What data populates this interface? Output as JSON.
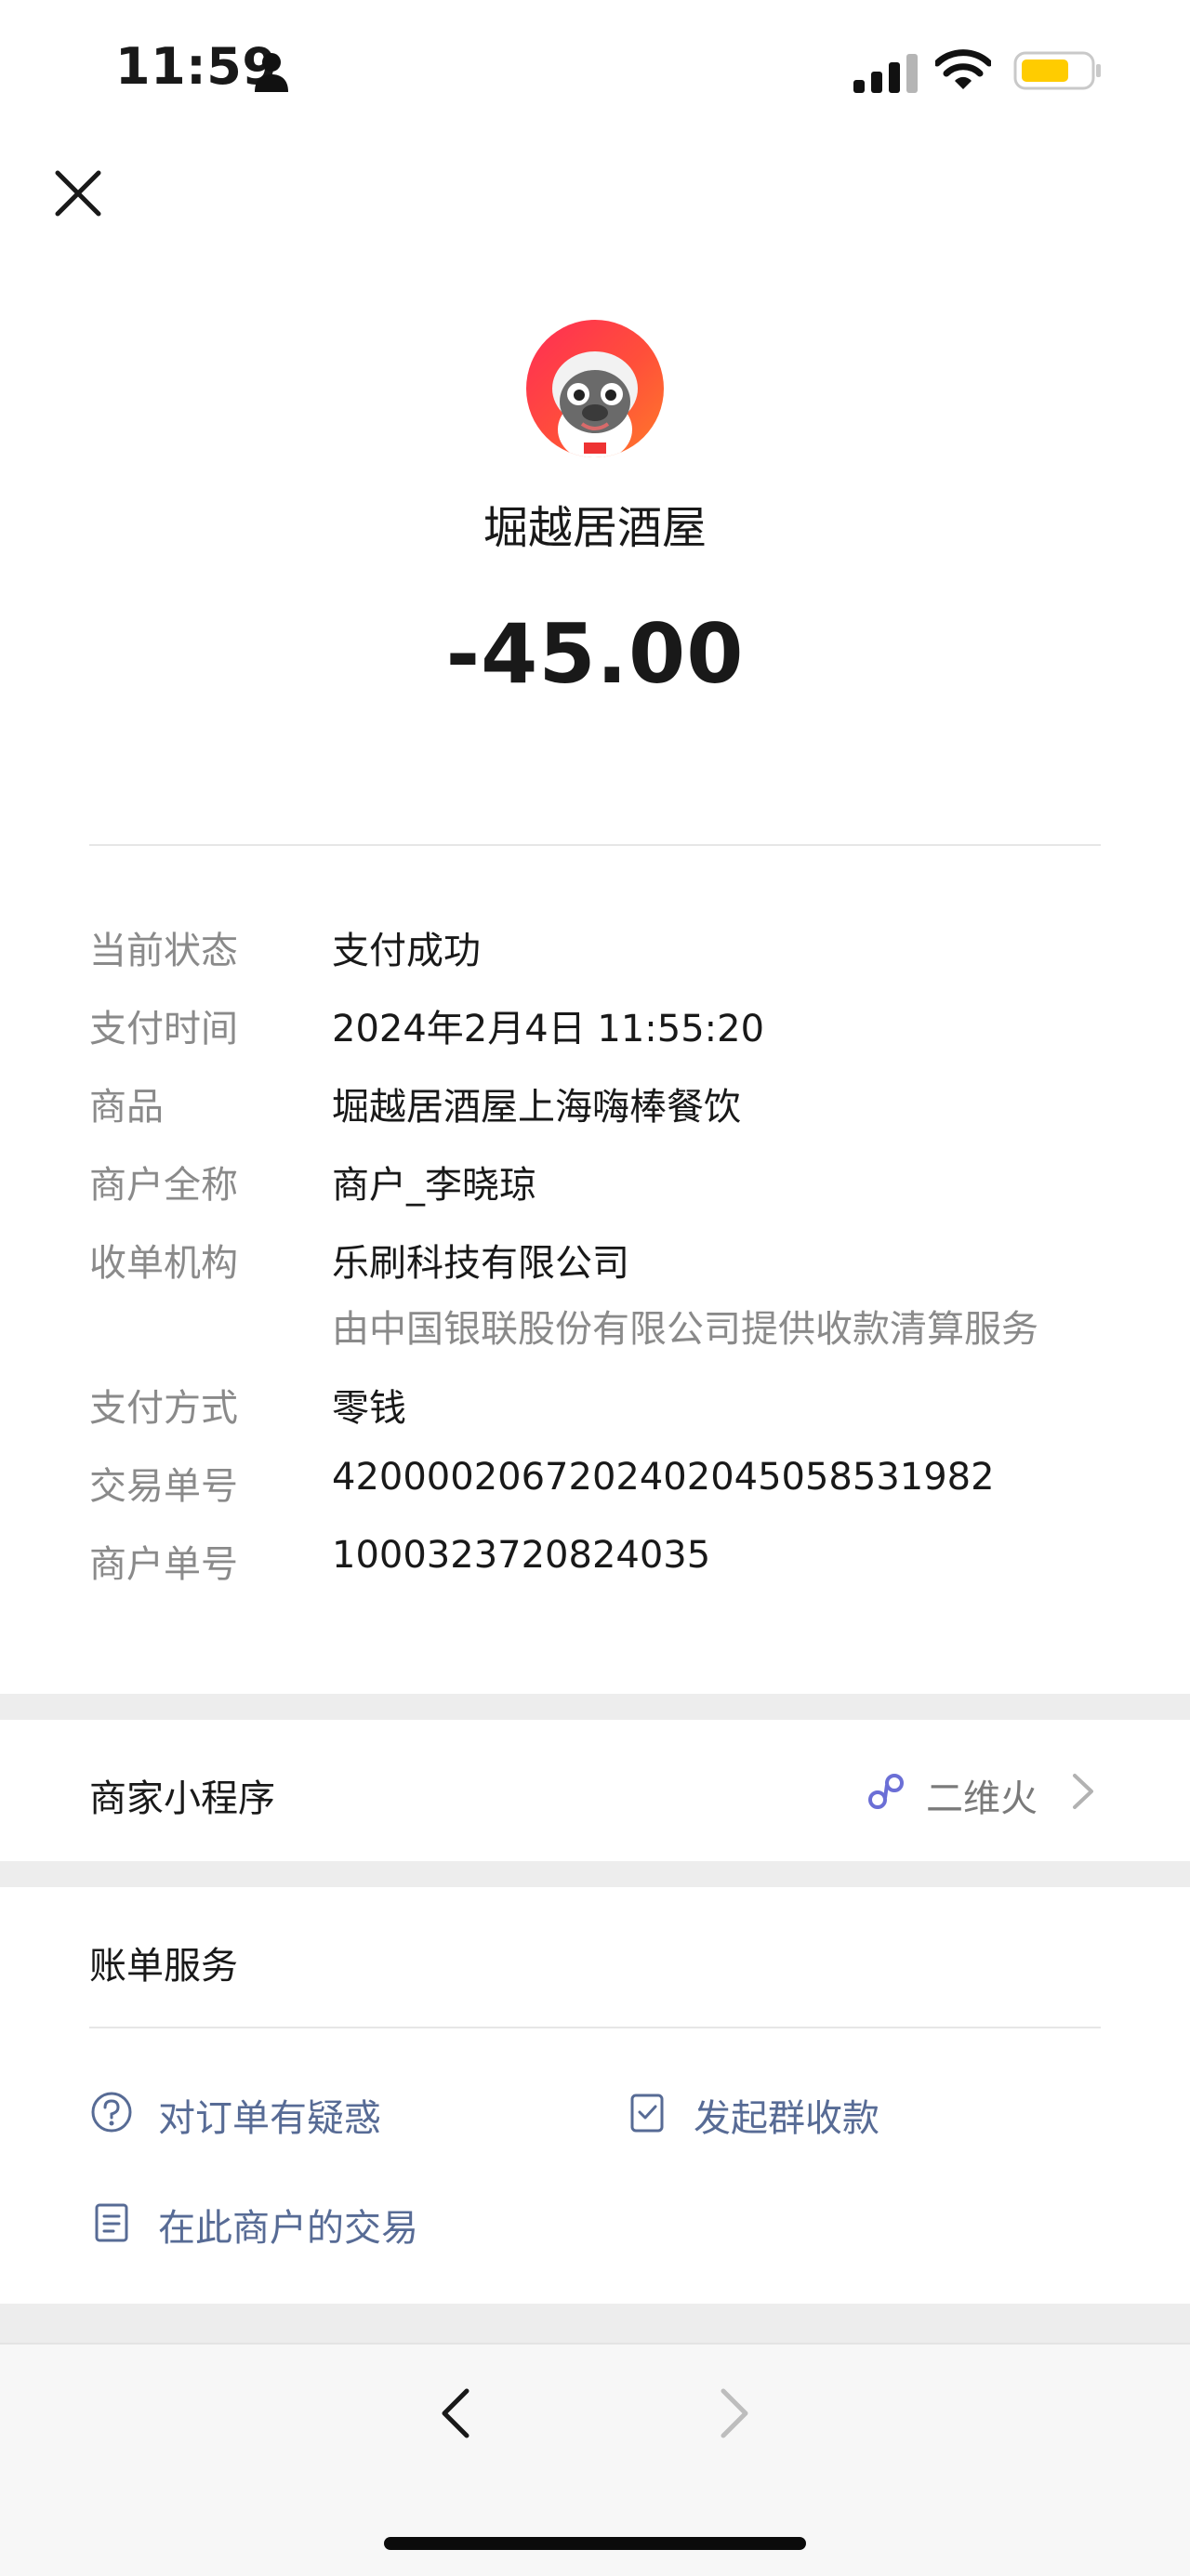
{
  "status_bar": {
    "time": "11:59",
    "battery_color": "#ffcc00"
  },
  "merchant": {
    "name": "堀越居酒屋",
    "amount": "-45.00"
  },
  "details": [
    {
      "label": "当前状态",
      "value": "支付成功"
    },
    {
      "label": "支付时间",
      "value": "2024年2月4日 11:55:20"
    },
    {
      "label": "商品",
      "value": "堀越居酒屋上海嗨棒餐饮"
    },
    {
      "label": "商户全称",
      "value": "商户_李晓琼"
    },
    {
      "label": "收单机构",
      "value": "乐刷科技有限公司",
      "sub": "由中国银联股份有限公司提供收款清算服务"
    },
    {
      "label": "支付方式",
      "value": "零钱"
    },
    {
      "label": "交易单号",
      "value": "4200002067202402045058531982"
    },
    {
      "label": "商户单号",
      "value": "1000323720824035"
    }
  ],
  "mini_program": {
    "label": "商家小程序",
    "value": "二维火"
  },
  "bill_service": {
    "title": "账单服务",
    "items": [
      {
        "label": "对订单有疑惑",
        "icon": "question-circle-icon"
      },
      {
        "label": "发起群收款",
        "icon": "group-collect-icon"
      },
      {
        "label": "在此商户的交易",
        "icon": "document-icon"
      }
    ]
  },
  "colors": {
    "link": "#576b95",
    "amount": "#191919",
    "avatar_gradient": [
      "#ff2d55",
      "#ff7a2a"
    ]
  }
}
